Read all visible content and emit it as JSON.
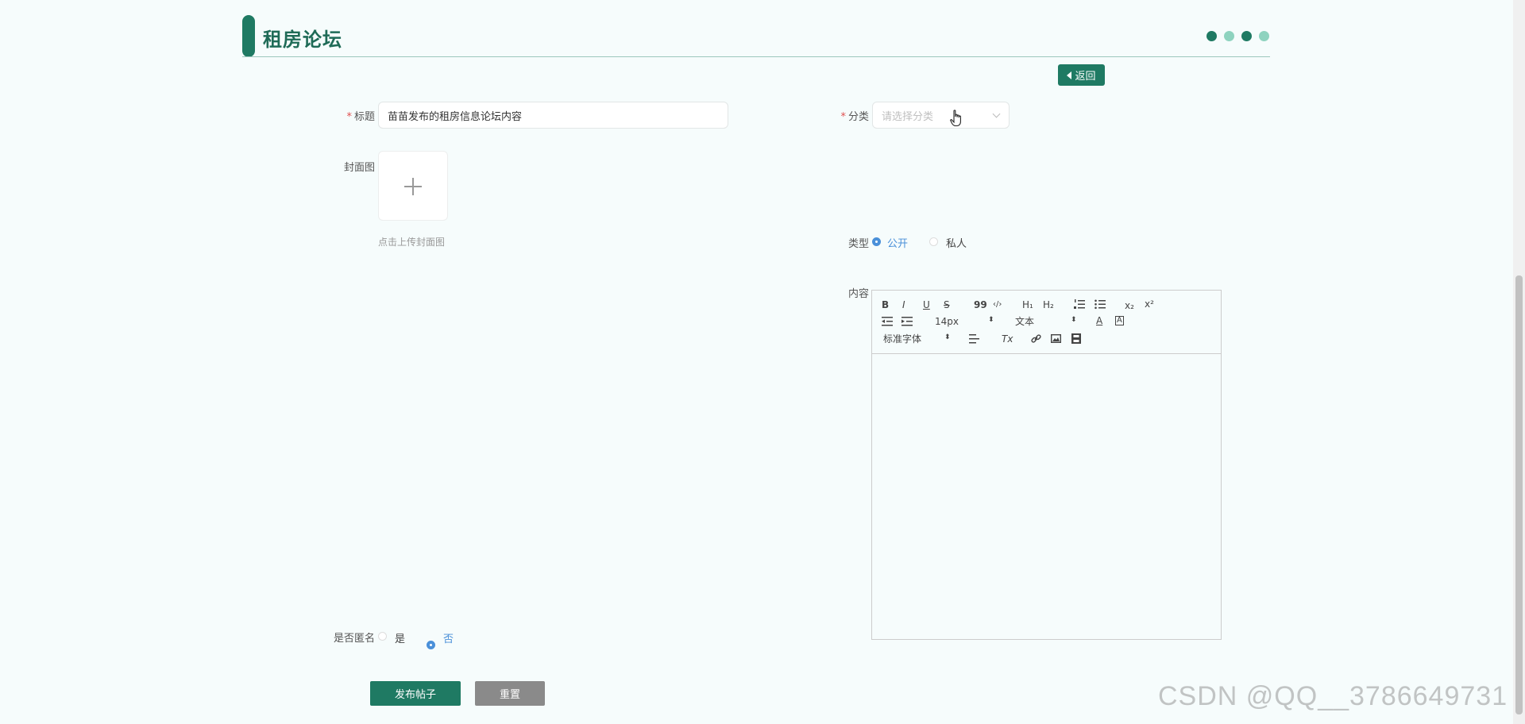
{
  "header": {
    "title": "租房论坛",
    "dots": [
      "#1f7a63",
      "#8ed3bf",
      "#1f7a63",
      "#8ed3bf"
    ],
    "back_label": "返回"
  },
  "form": {
    "title_label": "标题",
    "title_value": "苗苗发布的租房信息论坛内容",
    "category_label": "分类",
    "category_placeholder": "请选择分类",
    "cover_label": "封面图",
    "cover_hint": "点击上传封面图",
    "type_label": "类型",
    "type_options": [
      {
        "label": "公开",
        "selected": true
      },
      {
        "label": "私人",
        "selected": false
      }
    ],
    "content_label": "内容",
    "anonymous_label": "是否匿名",
    "anonymous_options": [
      {
        "label": "是",
        "selected": false
      },
      {
        "label": "否",
        "selected": true
      }
    ]
  },
  "editor": {
    "bold": "B",
    "italic": "I",
    "underline": "U",
    "strike": "S",
    "quote": "99",
    "code": "‹/›",
    "h1": "H₁",
    "h2": "H₂",
    "subscript": "x₂",
    "superscript": "x²",
    "size_value": "14px",
    "header_value": "文本",
    "font_value": "标准字体",
    "color_glyph": "A",
    "background_glyph": "A",
    "clear_glyph": "Tx"
  },
  "actions": {
    "submit_label": "发布帖子",
    "reset_label": "重置"
  },
  "watermark": "CSDN @QQ__3786649731",
  "colors": {
    "primary": "#1f7a63",
    "accent_radio": "#4a90d9",
    "reset_button": "#8a8a8a"
  }
}
